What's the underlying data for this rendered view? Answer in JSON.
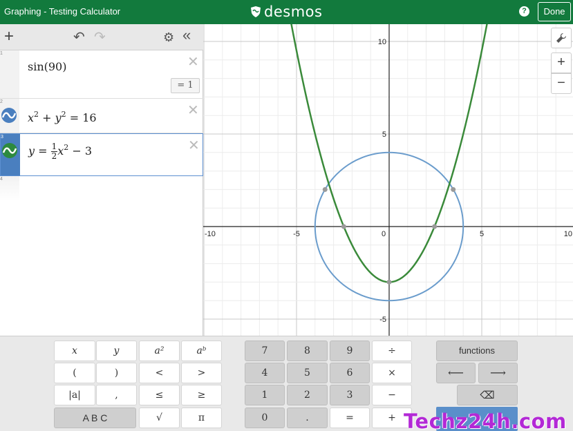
{
  "header": {
    "title": "Graphing - Testing Calculator",
    "logo_text": "desmos",
    "help_label": "?",
    "done_label": "Done"
  },
  "toolbar": {
    "add_label": "+",
    "undo_label": "↶",
    "redo_label": "↷",
    "settings_label": "⚙",
    "collapse_label": "«"
  },
  "expressions": [
    {
      "number": "1",
      "text": "sin(90)",
      "result": "= 1"
    },
    {
      "number": "2",
      "lhs": "x",
      "exp1": "2",
      "mid": " + y",
      "exp2": "2",
      "rhs": " = 16",
      "color": "#4a7fbf"
    },
    {
      "number": "3",
      "lhs": "y = ",
      "frac_num": "1",
      "frac_den": "2",
      "mid": "x",
      "exp1": "2",
      "rhs": " − 3",
      "color": "#2d8a3e"
    },
    {
      "number": "4"
    }
  ],
  "delete_label": "✕",
  "graph": {
    "x_ticks": [
      "-10",
      "-5",
      "0",
      "5",
      "10"
    ],
    "y_ticks": [
      "10",
      "5",
      "-5"
    ],
    "xlim": [
      -10,
      10
    ],
    "ylim": [
      -5.8,
      10.8
    ],
    "circle": {
      "radius": 4,
      "color": "#6a9ccc"
    },
    "parabola": {
      "a": 0.5,
      "c": -3,
      "color": "#3a8a3a"
    },
    "points": [
      [
        -3.46,
        2
      ],
      [
        3.46,
        2
      ],
      [
        -2.45,
        0
      ],
      [
        2.45,
        0
      ],
      [
        0,
        -3
      ]
    ],
    "tools": {
      "wrench": "🔧",
      "zoom_in": "+",
      "zoom_out": "−"
    }
  },
  "keypad": {
    "left": [
      [
        "x",
        "y",
        "a²",
        "aᵇ"
      ],
      [
        "(",
        ")",
        "<",
        ">"
      ],
      [
        "|a|",
        ",",
        "≤",
        "≥"
      ],
      [
        "A B C",
        "√",
        "π"
      ]
    ],
    "middle": [
      [
        "7",
        "8",
        "9",
        "÷"
      ],
      [
        "4",
        "5",
        "6",
        "×"
      ],
      [
        "1",
        "2",
        "3",
        "−"
      ],
      [
        "0",
        ".",
        "=",
        "+"
      ]
    ],
    "functions_label": "functions",
    "left_arrow": "⟵",
    "right_arrow": "⟶",
    "backspace": "⌫"
  },
  "watermark": "Techz24h.com"
}
